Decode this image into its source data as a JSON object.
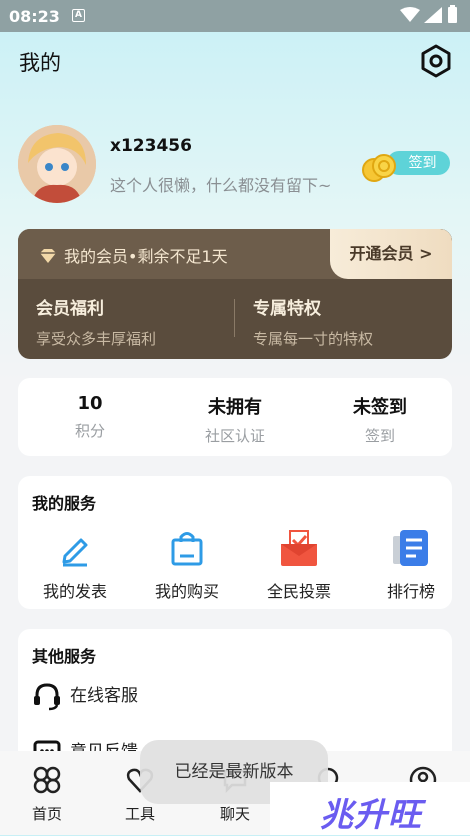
{
  "status_bar": {
    "time": "08:23",
    "notification_icon_letter": "A"
  },
  "header": {
    "title": "我的"
  },
  "profile": {
    "username": "x123456",
    "bio": "这个人很懒，什么都没有留下~",
    "checkin_label": "签到"
  },
  "vip": {
    "status": "我的会员•剩余不足1天",
    "open_button": "开通会员 >",
    "benefits": [
      {
        "title": "会员福利",
        "subtitle": "享受众多丰厚福利"
      },
      {
        "title": "专属特权",
        "subtitle": "专属每一寸的特权"
      }
    ]
  },
  "stats": [
    {
      "value": "10",
      "label": "积分"
    },
    {
      "value": "未拥有",
      "label": "社区认证"
    },
    {
      "value": "未签到",
      "label": "签到"
    }
  ],
  "my_services": {
    "title": "我的服务",
    "items": [
      {
        "label": "我的发表",
        "icon": "pencil-icon"
      },
      {
        "label": "我的购买",
        "icon": "shopping-bag-icon"
      },
      {
        "label": "全民投票",
        "icon": "vote-box-icon"
      },
      {
        "label": "排行榜",
        "icon": "document-list-icon"
      }
    ]
  },
  "other_services": {
    "title": "其他服务",
    "items": [
      {
        "label": "在线客服",
        "icon": "headset-icon"
      },
      {
        "label": "意见反馈",
        "icon": "chat-box-icon"
      }
    ]
  },
  "tabbar": [
    {
      "label": "首页",
      "icon": "home-grid-icon"
    },
    {
      "label": "工具",
      "icon": "heart-icon"
    },
    {
      "label": "聊天",
      "icon": "chat-bubble-icon"
    },
    {
      "label": "",
      "icon": "discover-icon"
    },
    {
      "label": "",
      "icon": "profile-icon"
    }
  ],
  "toast": "已经是最新版本",
  "watermark": "兆升旺",
  "colors": {
    "accent": "#5ed3d8",
    "vip_background": "#5a4c3d",
    "vote_red": "#f0553f",
    "link_blue": "#2e9be6"
  }
}
